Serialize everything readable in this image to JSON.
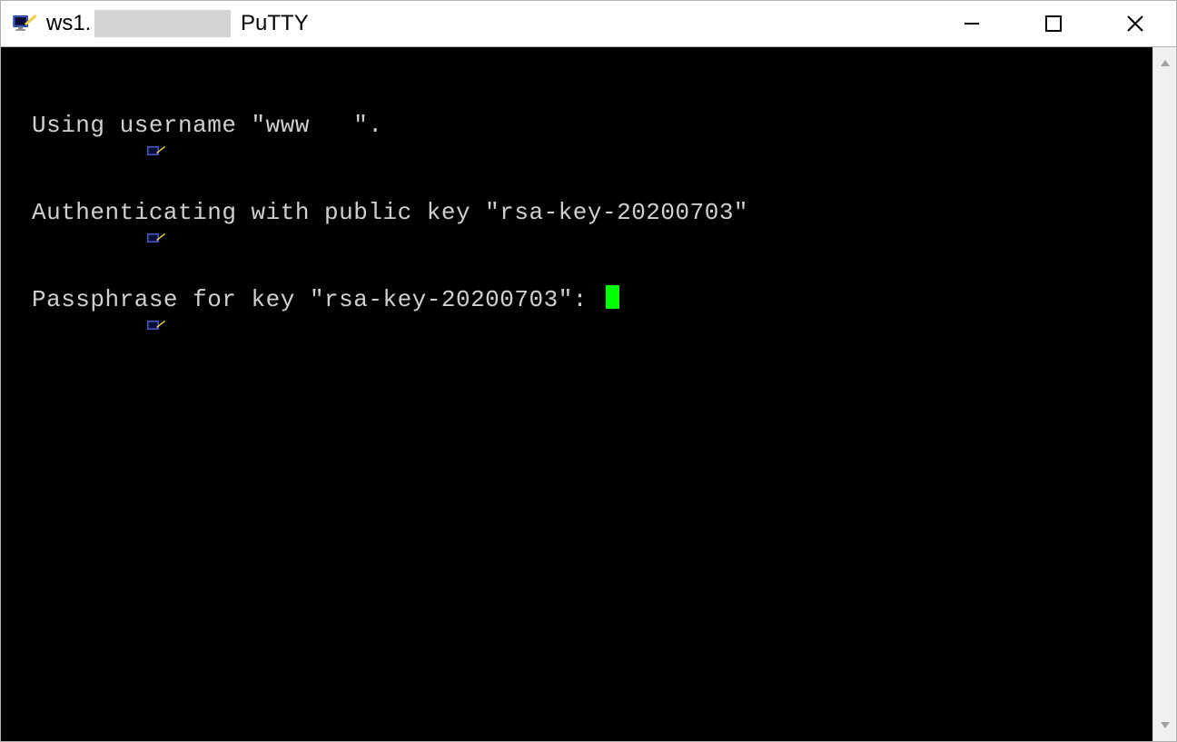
{
  "window": {
    "title_prefix": "ws1.",
    "title_suffix": " PuTTY"
  },
  "terminal": {
    "lines": [
      "Using username \"www   \".",
      "Authenticating with public key \"rsa-key-20200703\"",
      "Passphrase for key \"rsa-key-20200703\": "
    ]
  },
  "colors": {
    "cursor": "#00ff00",
    "bg": "#000000",
    "fg": "#d0d0d0"
  }
}
